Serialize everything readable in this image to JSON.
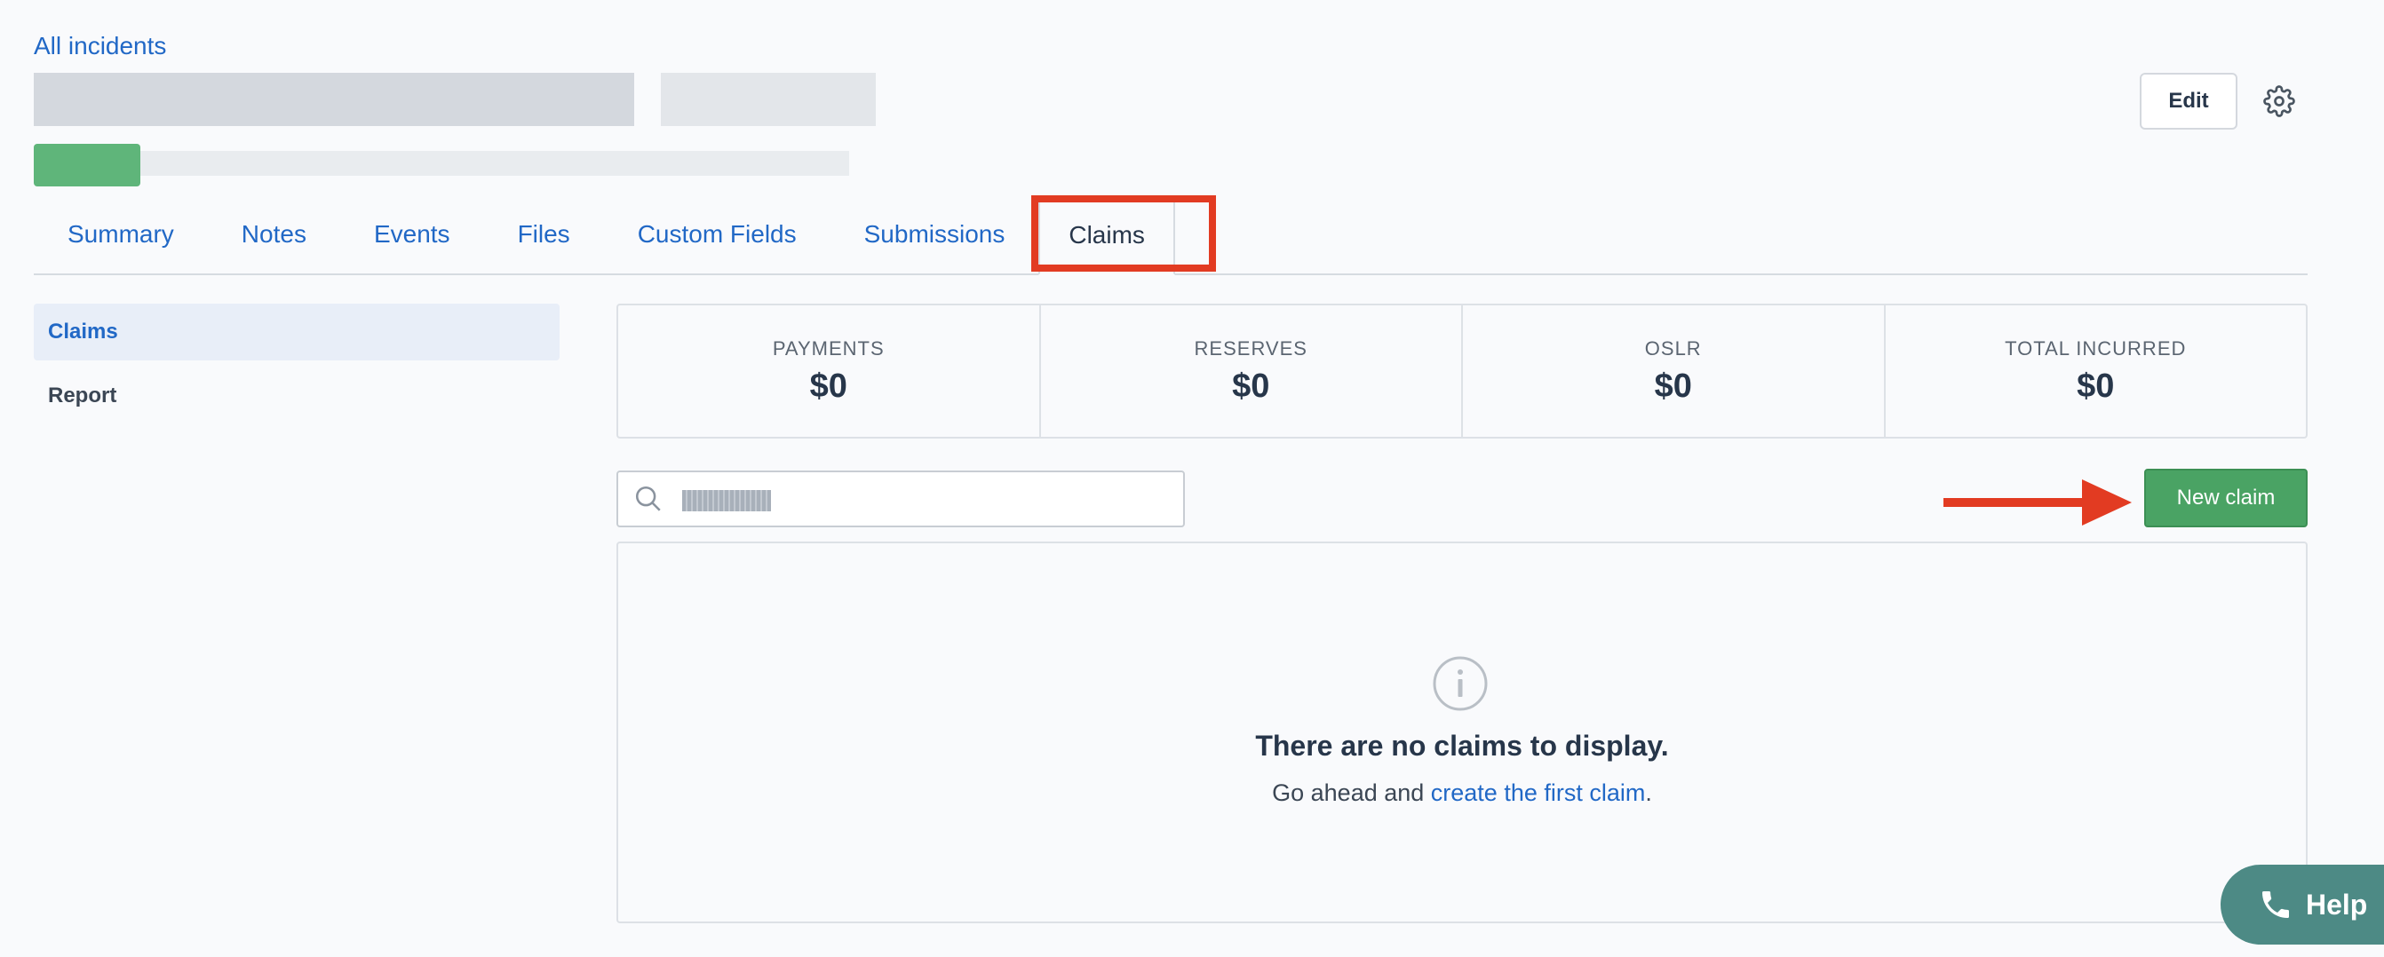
{
  "header": {
    "breadcrumb": "All incidents",
    "edit_label": "Edit"
  },
  "tabs": [
    {
      "label": "Summary"
    },
    {
      "label": "Notes"
    },
    {
      "label": "Events"
    },
    {
      "label": "Files"
    },
    {
      "label": "Custom Fields"
    },
    {
      "label": "Submissions"
    },
    {
      "label": "Claims",
      "active": true
    }
  ],
  "sidebar": {
    "items": [
      {
        "label": "Claims",
        "active": true
      },
      {
        "label": "Report"
      }
    ]
  },
  "totals": [
    {
      "label": "PAYMENTS",
      "value": "$0"
    },
    {
      "label": "RESERVES",
      "value": "$0"
    },
    {
      "label": "OSLR",
      "value": "$0"
    },
    {
      "label": "TOTAL INCURRED",
      "value": "$0"
    }
  ],
  "search": {
    "placeholder": ""
  },
  "actions": {
    "new_claim_label": "New claim"
  },
  "empty_state": {
    "title": "There are no claims to display.",
    "prefix": "Go ahead and ",
    "link": "create the first claim",
    "suffix": "."
  },
  "help": {
    "label": "Help"
  },
  "colors": {
    "link": "#2168c6",
    "success": "#4aa364",
    "annotation": "#e23b22",
    "help": "#4d8a85"
  },
  "icons": [
    "gear-icon",
    "search-icon",
    "info-icon",
    "phone-icon",
    "arrow-right-icon"
  ]
}
